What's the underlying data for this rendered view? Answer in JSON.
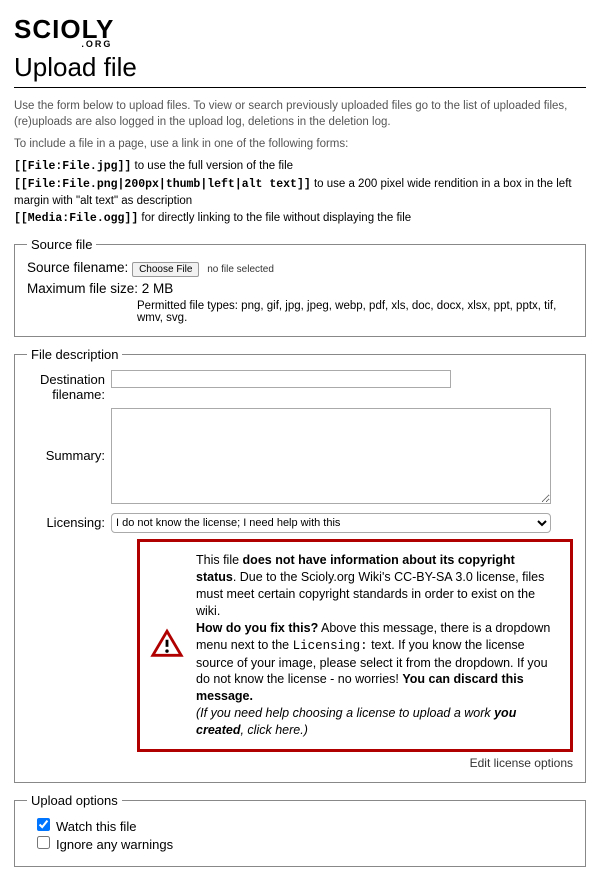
{
  "logo": {
    "main": "SCIOLY",
    "sub": ".ORG"
  },
  "page_title": "Upload file",
  "intro": {
    "line1": "Use the form below to upload files. To view or search previously uploaded files go to the list of uploaded files, (re)uploads are also logged in the upload log, deletions in the deletion log.",
    "line2": "To include a file in a page, use a link in one of the following forms:"
  },
  "syntax": {
    "ex1_code": "[[File:File.jpg]]",
    "ex1_text": " to use the full version of the file",
    "ex2_code": "[[File:File.png|200px|thumb|left|alt text]]",
    "ex2_text": " to use a 200 pixel wide rendition in a box in the left margin with \"alt text\" as description",
    "ex3_code": "[[Media:File.ogg]]",
    "ex3_text": " for directly linking to the file without displaying the file"
  },
  "source_file": {
    "legend": "Source file",
    "filename_label": "Source filename:",
    "choose_btn": "Choose File",
    "no_file": "no file selected",
    "maxsize": "Maximum file size: 2 MB",
    "permitted": "Permitted file types: png, gif, jpg, jpeg, webp, pdf, xls, doc, docx, xlsx, ppt, pptx, tif, wmv, svg."
  },
  "file_desc": {
    "legend": "File description",
    "dest_label": "Destination filename:",
    "summary_label": "Summary:",
    "licensing_label": "Licensing:",
    "licensing_selected": "I do not know the license; I need help with this",
    "warn": {
      "p1a": "This file ",
      "p1b": "does not have information about its copyright status",
      "p1c": ". Due to the Scioly.org Wiki's CC-BY-SA 3.0 license, files must meet certain copyright standards in order to exist on the wiki.",
      "p2a": "How do you fix this?",
      "p2b": " Above this message, there is a dropdown menu next to the ",
      "p2c": "Licensing:",
      "p2d": " text. If you know the license source of your image, please select it from the dropdown. If you do not know the license - no worries! ",
      "p2e": "You can discard this message.",
      "p3a": "(If you need help choosing a license to upload a work ",
      "p3b": "you created",
      "p3c": ", click here.)"
    },
    "edit_license": "Edit license options"
  },
  "upload_opts": {
    "legend": "Upload options",
    "watch": "Watch this file",
    "ignore": "Ignore any warnings"
  }
}
